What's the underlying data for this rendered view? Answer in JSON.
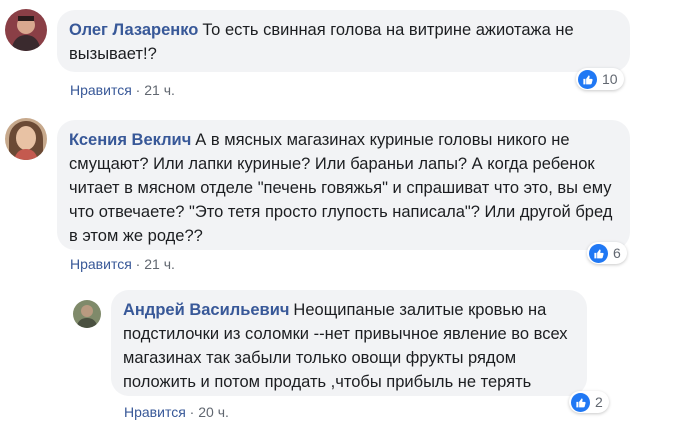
{
  "comments": [
    {
      "author": "Олег Лазаренко",
      "text": "То есть свинная голова на витрине ажиотажа не вызывает!?",
      "like_label": "Нравится",
      "separator": "·",
      "time": "21 ч.",
      "reactions": "10"
    },
    {
      "author": "Ксения Веклич",
      "text": "А в мясных магазинах куриные головы никого не смущают? Или лапки куриные? Или бараньи лапы? А когда ребенок читает в мясном отделе \"печень говяжья\" и спрашиват что это, вы ему что отвечаете? \"Это тетя просто глупость написала\"? Или другой бред в этом же роде??",
      "like_label": "Нравится",
      "separator": "·",
      "time": "21 ч.",
      "reactions": "6"
    },
    {
      "author": "Андрей Васильевич",
      "text": "Неощипаные залитые кровью на подстилочки из соломки --нет привычное явление во всех магазинах так забыли только овощи фрукты рядом положить и потом продать ,чтобы прибыль не терять",
      "like_label": "Нравится",
      "separator": "·",
      "time": "20 ч.",
      "reactions": "2"
    }
  ],
  "colors": {
    "author": "#385898",
    "bubble": "#f2f3f5",
    "like_blue": "#2078f4",
    "meta": "#616770"
  },
  "icons": {
    "reaction": "thumbs-up-icon"
  }
}
